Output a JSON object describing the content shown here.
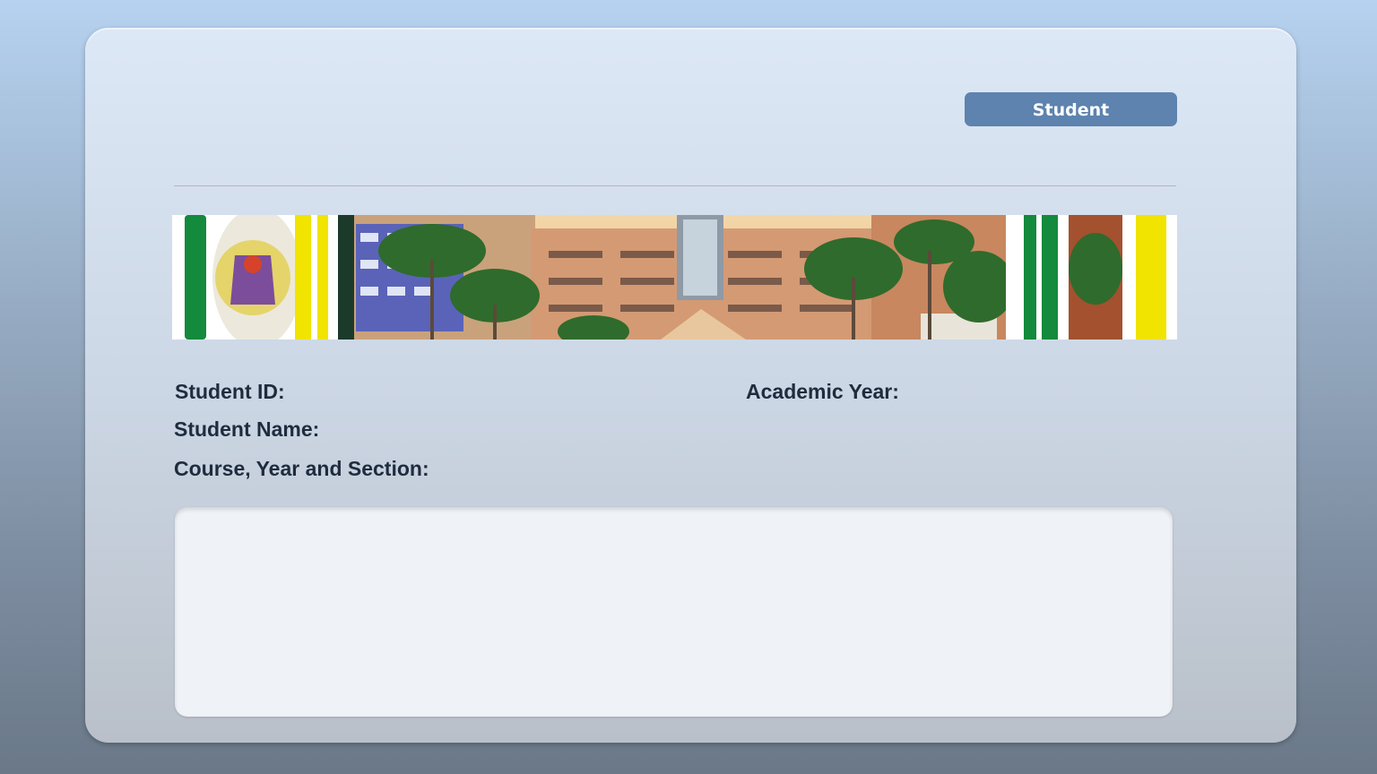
{
  "header": {
    "role_button_label": "Student"
  },
  "banner": {
    "description_icon": "campus-banner-image"
  },
  "student_info": {
    "student_id_label": "Student ID:",
    "student_name_label": "Student Name:",
    "course_label": "Course, Year and Section:",
    "academic_year_label": "Academic Year:"
  },
  "colors": {
    "accent": "#5d83ae",
    "label_text": "#1f2c3e",
    "banner_green": "#138a3c",
    "banner_yellow": "#f1e400"
  }
}
